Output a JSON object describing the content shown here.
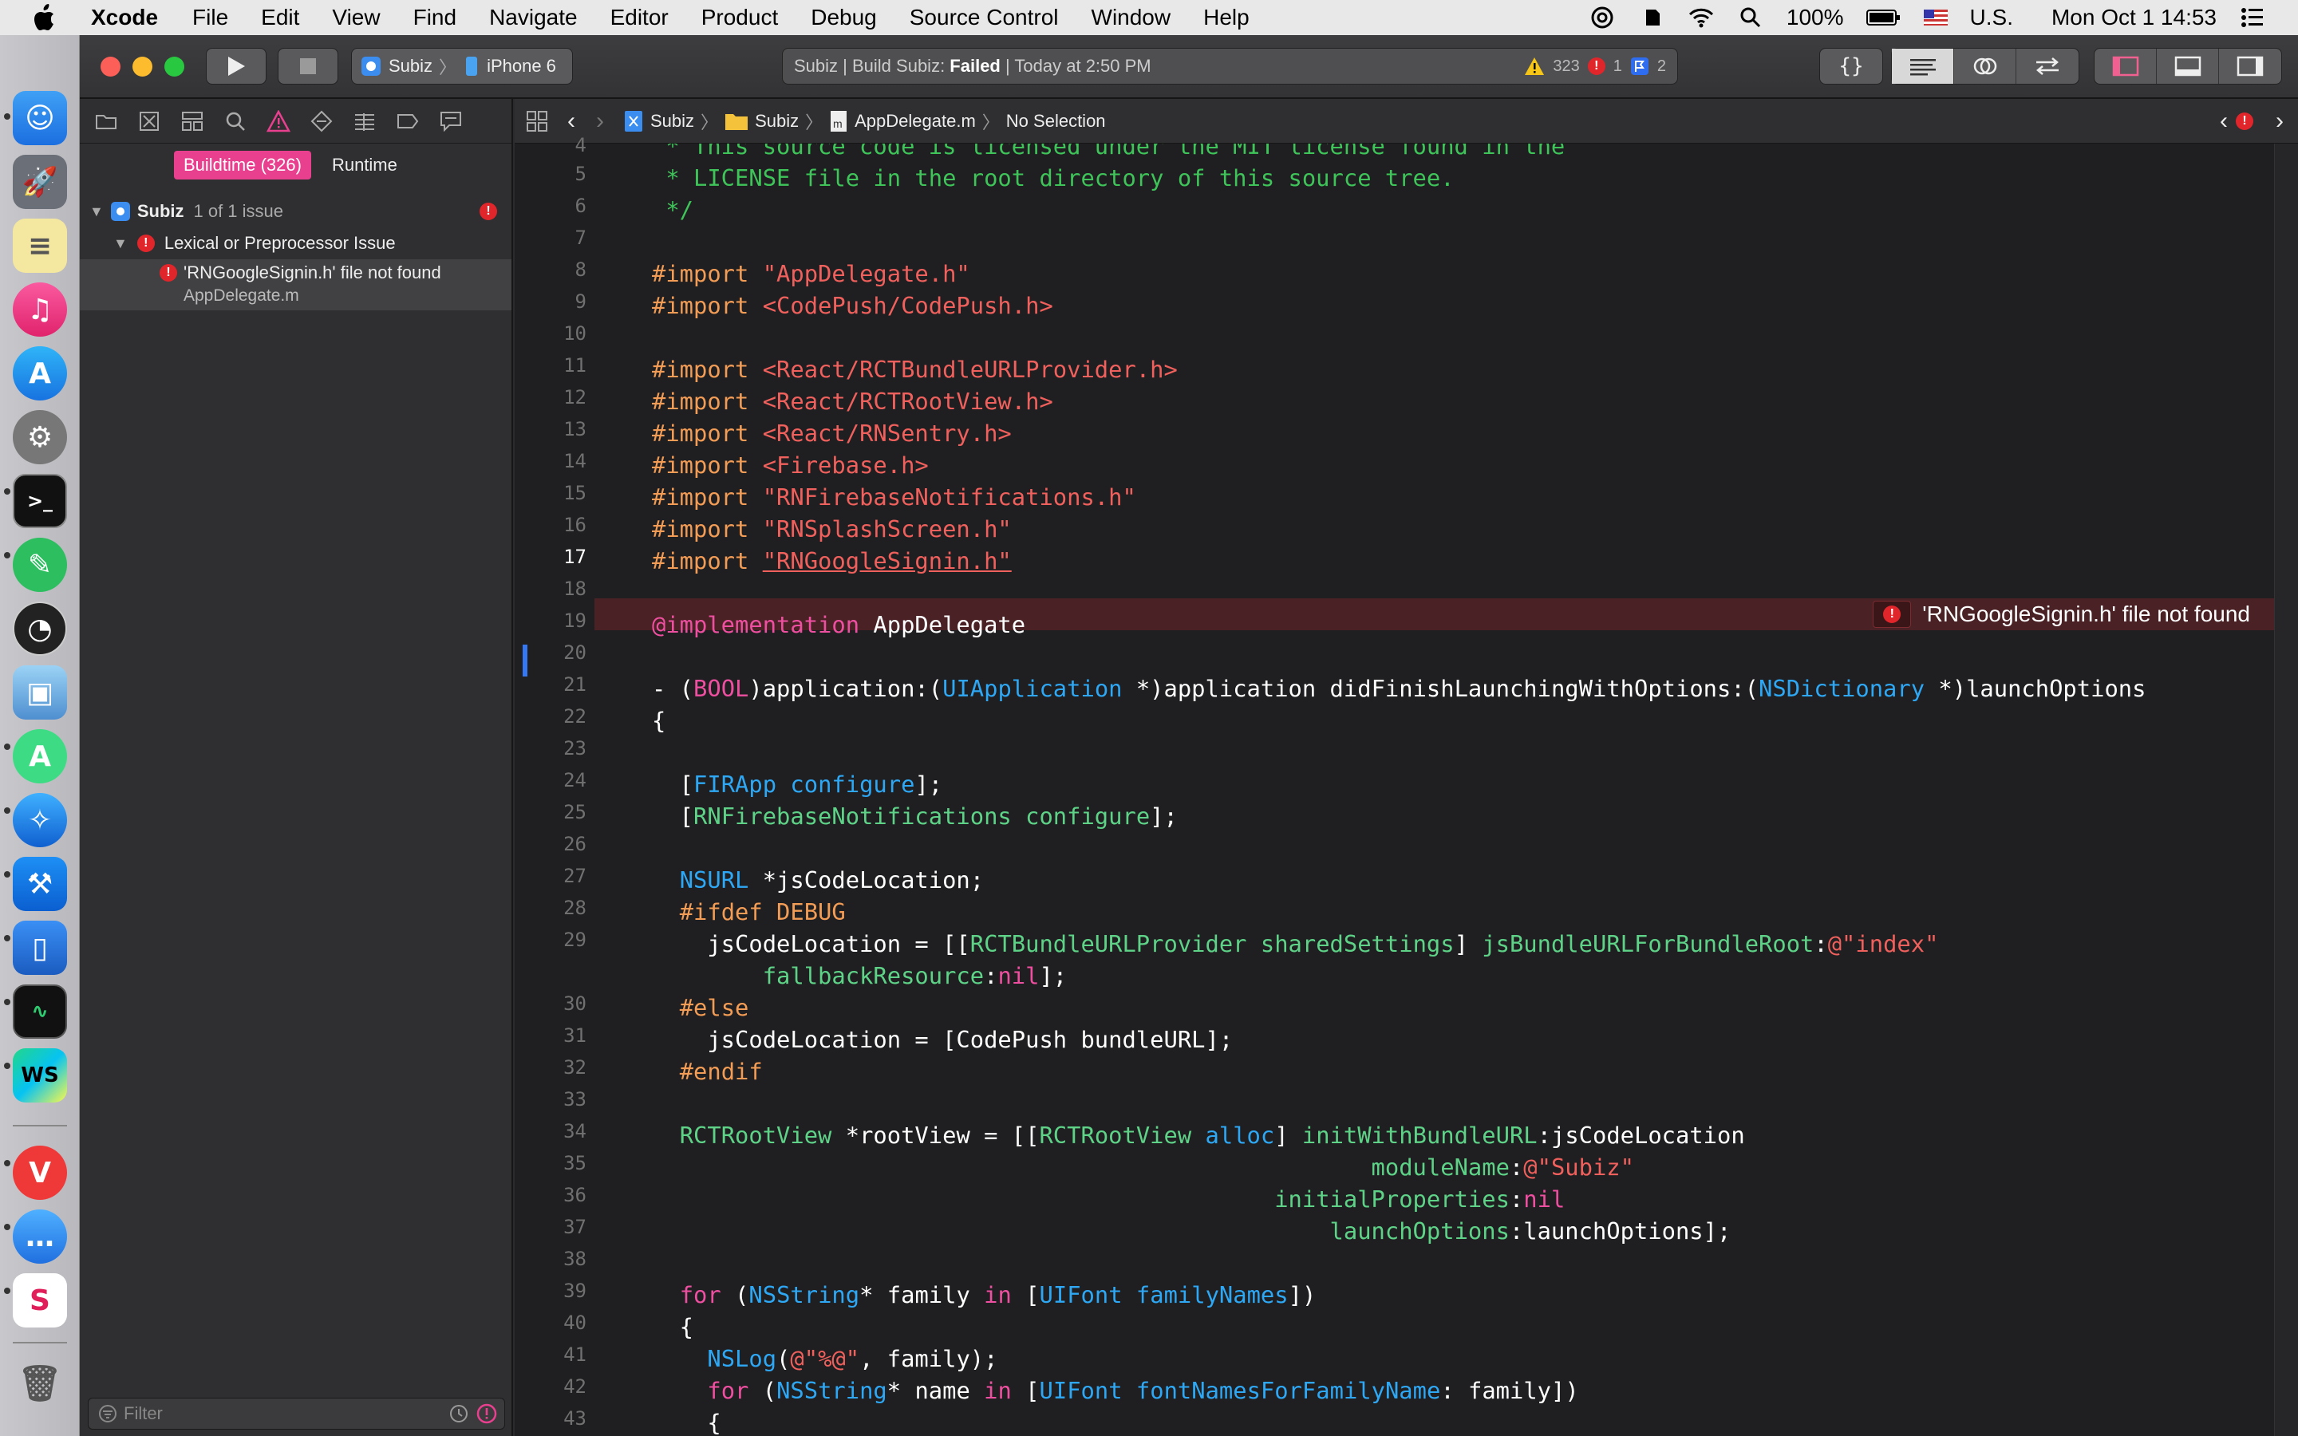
{
  "menubar": {
    "app": "Xcode",
    "items": [
      "File",
      "Edit",
      "View",
      "Find",
      "Navigate",
      "Editor",
      "Product",
      "Debug",
      "Source Control",
      "Window",
      "Help"
    ],
    "battery": "100%",
    "input_source": "U.S.",
    "clock": "Mon Oct 1  14:53"
  },
  "toolbar": {
    "scheme": "Subiz",
    "device": "iPhone 6",
    "activity_project": "Subiz",
    "activity_prefix": "Build Subiz: ",
    "activity_state": "Failed",
    "activity_time": "Today at 2:50 PM",
    "warnings": "323",
    "errors": "1",
    "analyzer": "2"
  },
  "navigator": {
    "tab_buildtime": "Buildtime (326)",
    "tab_runtime": "Runtime",
    "project": "Subiz",
    "project_count": "1 of 1 issue",
    "category": "Lexical or Preprocessor Issue",
    "issue_title": "'RNGoogleSignin.h' file not found",
    "issue_file": "AppDelegate.m",
    "filter_placeholder": "Filter"
  },
  "jumpbar": {
    "project": "Subiz",
    "group": "Subiz",
    "file": "AppDelegate.m",
    "selection": "No Selection"
  },
  "editor": {
    "error_message": "'RNGoogleSignin.h' file not found",
    "current_line": "17",
    "line_numbers": [
      "4",
      "5",
      "6",
      "7",
      "8",
      "9",
      "10",
      "11",
      "12",
      "13",
      "14",
      "15",
      "16",
      "17",
      "18",
      "19",
      "20",
      "21",
      "22",
      "23",
      "24",
      "25",
      "26",
      "27",
      "28",
      "29",
      "30",
      "31",
      "32",
      "33",
      "34",
      "35",
      "36",
      "37",
      "38",
      "39",
      "40",
      "41",
      "42",
      "43"
    ]
  },
  "colors": {
    "comment": "#3fc45a",
    "keyword": "#ef4fa0",
    "string": "#f0605c",
    "type": "#2ea8f5",
    "method": "#5ed388",
    "error_line_bg": "#4a2226",
    "accent_pink": "#e8408e"
  }
}
